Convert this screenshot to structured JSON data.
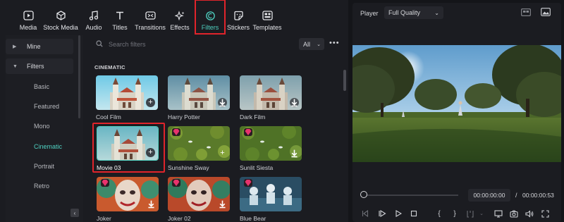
{
  "toolbar": {
    "items": [
      {
        "label": "Media",
        "icon": "media-icon"
      },
      {
        "label": "Stock Media",
        "icon": "stock-media-icon"
      },
      {
        "label": "Audio",
        "icon": "music-note-icon"
      },
      {
        "label": "Titles",
        "icon": "text-t-icon"
      },
      {
        "label": "Transitions",
        "icon": "transitions-icon"
      },
      {
        "label": "Effects",
        "icon": "sparkle-icon"
      },
      {
        "label": "Filters",
        "icon": "filters-icon",
        "active": true
      },
      {
        "label": "Stickers",
        "icon": "sticker-icon"
      },
      {
        "label": "Templates",
        "icon": "templates-icon"
      }
    ]
  },
  "sidebar": {
    "mine": "Mine",
    "filters": "Filters",
    "sub_items": [
      "Basic",
      "Featured",
      "Mono",
      "Cinematic",
      "Portrait",
      "Retro"
    ],
    "active_sub": "Cinematic"
  },
  "search": {
    "placeholder": "Search filters"
  },
  "filter_select": {
    "value": "All"
  },
  "section_title": "CINEMATIC",
  "cards": [
    {
      "label": "Cool Film",
      "action": "add"
    },
    {
      "label": "Harry Potter",
      "action": "download"
    },
    {
      "label": "Dark Film",
      "action": "download"
    },
    {
      "label": "Movie 03",
      "action": "add",
      "selected": true
    },
    {
      "label": "Sunshine Sway",
      "action": "add",
      "premium": true
    },
    {
      "label": "Sunlit Siesta",
      "action": "download",
      "premium": true
    },
    {
      "label": "Joker",
      "action": "download",
      "premium": true
    },
    {
      "label": "Joker 02",
      "action": "download",
      "premium": true
    },
    {
      "label": "Blue Bear",
      "action": "download",
      "premium": true
    }
  ],
  "player": {
    "label": "Player",
    "quality": "Full Quality",
    "time_current": "00:00:00:00",
    "time_separator": "/",
    "time_total": "00:00:00:53",
    "progress": 0
  },
  "colors": {
    "accent": "#4fd1c1",
    "highlight": "#e0242b",
    "premium": "#e8336d"
  }
}
